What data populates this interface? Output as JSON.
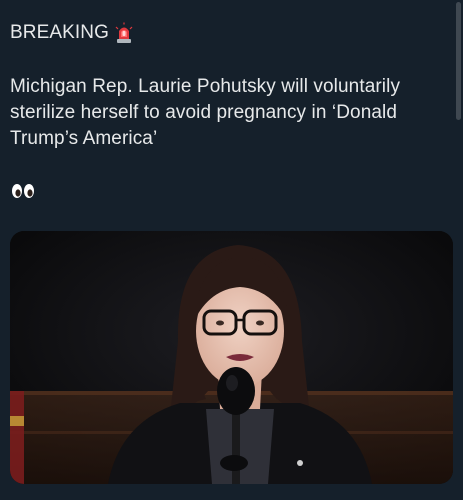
{
  "post": {
    "label": "BREAKING",
    "label_icon": "rotating-light-icon",
    "text": "Michigan Rep. Laurie Pohutsky will voluntarily sterilize herself to avoid pregnancy in ‘Donald Trump’s America’",
    "reaction_icon": "eyes-icon"
  },
  "media": {
    "image_subject": "woman-with-glasses-at-microphone",
    "accent_colors": {
      "background": "#15202b",
      "text": "#e7e9ea"
    }
  }
}
